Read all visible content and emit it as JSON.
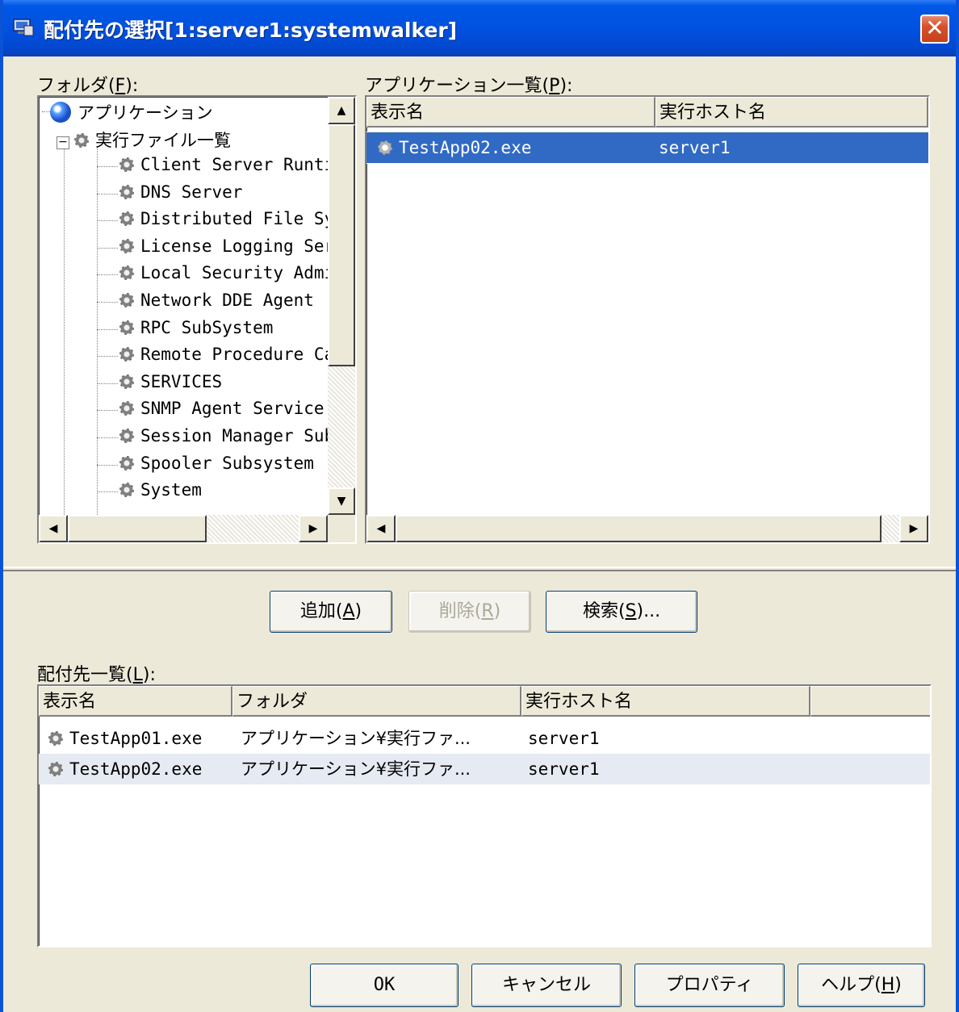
{
  "window": {
    "title": "配付先の選択[1:server1:systemwalker]",
    "close_glyph": "✕"
  },
  "folder_panel": {
    "label": "フォルダ(",
    "label_key": "F",
    "label_end": "):",
    "root": "アプリケーション",
    "group": "実行ファイル一覧",
    "items": [
      "Client Server Runti",
      "DNS Server",
      "Distributed File Sy",
      "License Logging Ser",
      "Local Security Admi",
      "Network DDE Agent",
      "RPC SubSystem",
      "Remote Procedure Ca",
      "SERVICES",
      "SNMP Agent Service",
      "Session Manager Sub",
      "Spooler Subsystem",
      "System"
    ]
  },
  "app_panel": {
    "label": "アプリケーション一覧(",
    "label_key": "P",
    "label_end": "):",
    "columns": [
      "表示名",
      "実行ホスト名"
    ],
    "rows": [
      {
        "name": "TestApp02.exe",
        "host": "server1",
        "selected": true
      }
    ]
  },
  "actions": {
    "add": "追加(",
    "add_key": "A",
    "delete": "削除(",
    "delete_key": "R",
    "search": "検索(",
    "search_key": "S",
    "search_end": ")...",
    "close_paren": ")"
  },
  "dest_panel": {
    "label": "配付先一覧(",
    "label_key": "L",
    "label_end": "):",
    "columns": [
      "表示名",
      "フォルダ",
      "実行ホスト名"
    ],
    "rows": [
      {
        "name": "TestApp01.exe",
        "folder": "アプリケーション¥実行ファ...",
        "host": "server1"
      },
      {
        "name": "TestApp02.exe",
        "folder": "アプリケーション¥実行ファ...",
        "host": "server1"
      }
    ]
  },
  "footer": {
    "ok": "OK",
    "cancel": "キャンセル",
    "properties": "プロパティ",
    "help": "ヘルプ(",
    "help_key": "H",
    "help_end": ")"
  },
  "scroll_glyphs": {
    "up": "▲",
    "down": "▼",
    "left": "◀",
    "right": "▶"
  }
}
